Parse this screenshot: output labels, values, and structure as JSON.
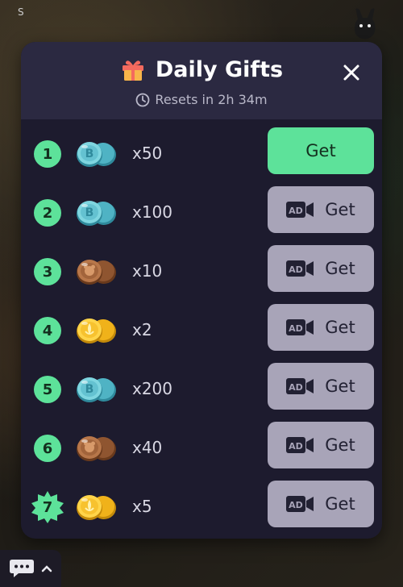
{
  "dialog": {
    "title": "Daily Gifts",
    "reset_text": "Resets in 2h 34m",
    "close_label": "✕"
  },
  "background": {
    "corner_text": "S"
  },
  "gifts": [
    {
      "rank": "1",
      "coin": "blue",
      "amount": "x50",
      "button_label": "Get",
      "type": "free"
    },
    {
      "rank": "2",
      "coin": "blue",
      "amount": "x100",
      "button_label": "Get",
      "type": "ad"
    },
    {
      "rank": "3",
      "coin": "bronze",
      "amount": "x10",
      "button_label": "Get",
      "type": "ad"
    },
    {
      "rank": "4",
      "coin": "gold",
      "amount": "x2",
      "button_label": "Get",
      "type": "ad"
    },
    {
      "rank": "5",
      "coin": "blue",
      "amount": "x200",
      "button_label": "Get",
      "type": "ad"
    },
    {
      "rank": "6",
      "coin": "bronze",
      "amount": "x40",
      "button_label": "Get",
      "type": "ad"
    },
    {
      "rank": "7",
      "coin": "gold",
      "amount": "x5",
      "button_label": "Get",
      "type": "ad"
    }
  ],
  "ad_badge": "AD",
  "colors": {
    "modal_bg": "#1d1b2e",
    "header_bg": "#2b2941",
    "accent_green": "#5de29a",
    "ad_button": "#a8a4b8"
  }
}
